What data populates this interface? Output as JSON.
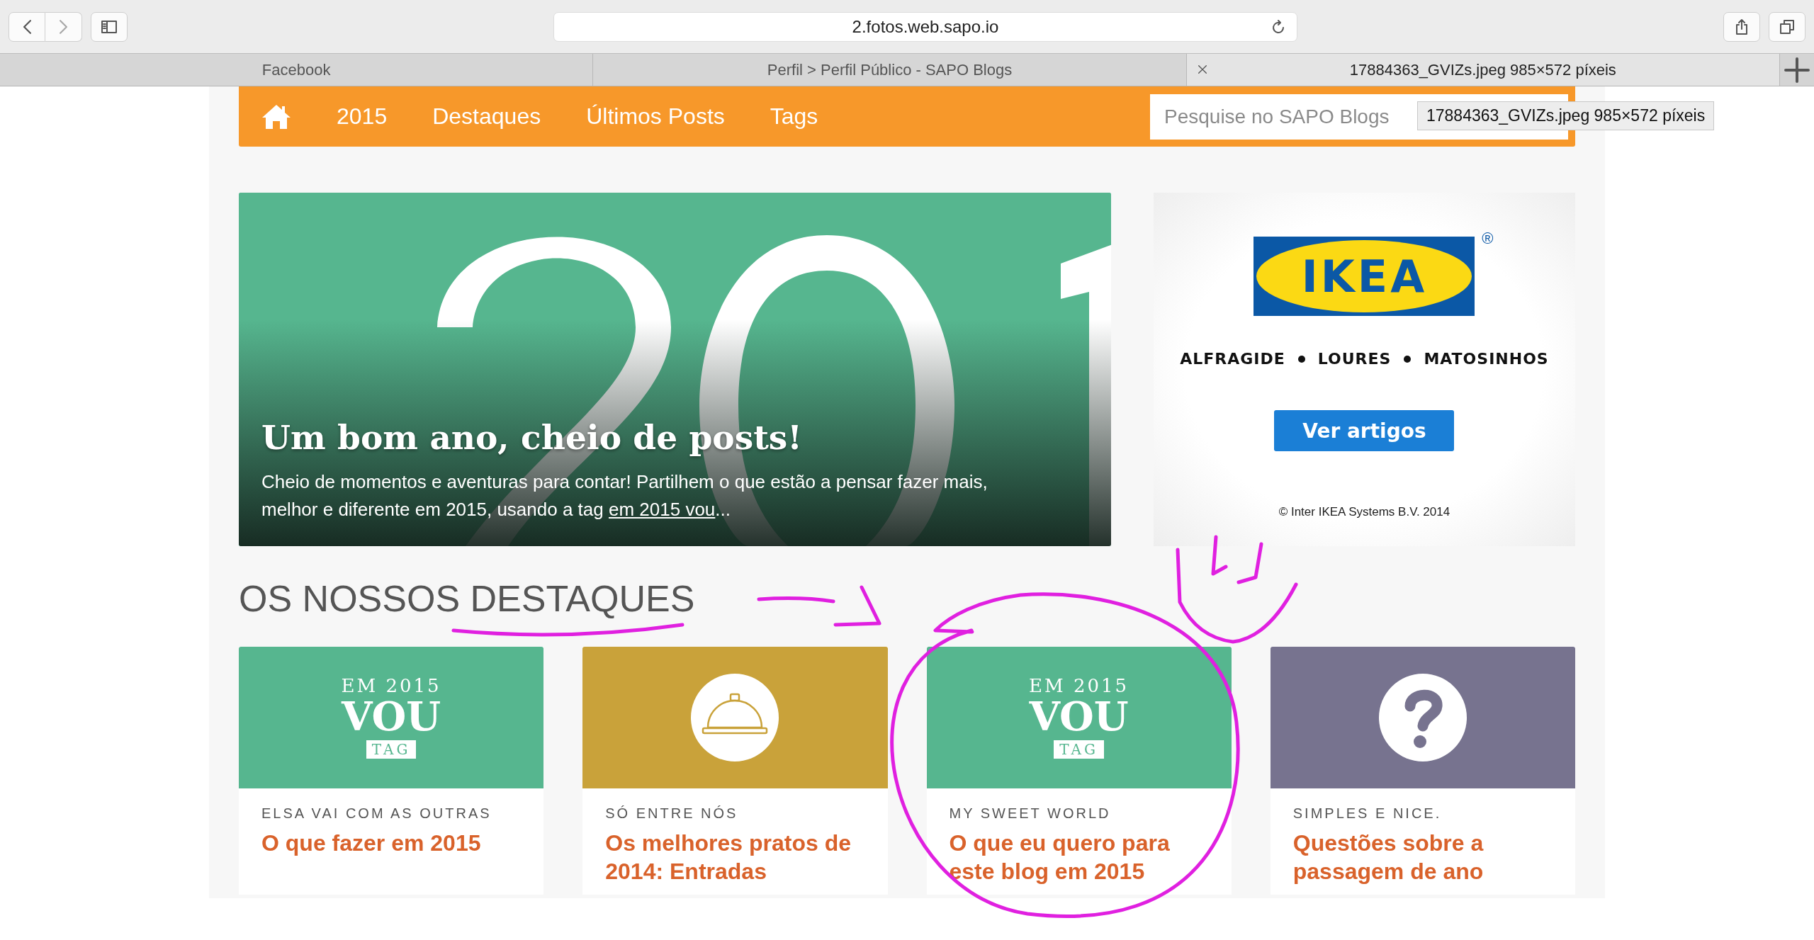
{
  "browser": {
    "back_disabled": false,
    "forward_disabled": true,
    "address": "2.fotos.web.sapo.io",
    "tabs": [
      {
        "title": "Facebook",
        "selected": false
      },
      {
        "title": "Perfil > Perfil Público - SAPO Blogs",
        "selected": false
      },
      {
        "title": "17884363_GVIZs.jpeg 985×572 píxeis",
        "selected": true
      }
    ],
    "tooltip": "17884363_GVIZs.jpeg 985×572 píxeis"
  },
  "nav": {
    "items": [
      "2015",
      "Destaques",
      "Últimos Posts",
      "Tags"
    ],
    "search": {
      "placeholder": "Pesquise no SAPO Blogs"
    }
  },
  "hero": {
    "title": "Um bom ano, cheio de posts!",
    "body": "Cheio de momentos e aventuras para contar! Partilhem o que estão a pensar fazer mais, melhor e diferente em 2015, usando a tag ",
    "link": "em 2015 vou",
    "after": "..."
  },
  "ad": {
    "logo": "IKEA",
    "registered": "®",
    "locations": [
      "ALFRAGIDE",
      "LOURES",
      "MATOSINHOS"
    ],
    "button": "Ver artigos",
    "copyright": "© Inter IKEA Systems B.V. 2014"
  },
  "section_title": "OS NOSSOS DESTAQUES",
  "cards": [
    {
      "kind": "vou",
      "color": "#56b68f",
      "badge": {
        "top": "EM 2015",
        "main": "VOU",
        "tag": "TAG"
      },
      "blog": "ELSA VAI COM AS OUTRAS",
      "title": "O que fazer em 2015"
    },
    {
      "kind": "cloche",
      "color": "#c9a23a",
      "blog": "SÓ ENTRE NÓS",
      "title": "Os melhores pratos de 2014: Entradas"
    },
    {
      "kind": "vou",
      "color": "#56b68f",
      "badge": {
        "top": "EM 2015",
        "main": "VOU",
        "tag": "TAG"
      },
      "blog": "MY SWEET WORLD",
      "title": "O que eu quero para este blog em 2015"
    },
    {
      "kind": "question",
      "color": "#77738f",
      "blog": "SIMPLES E NICE.",
      "title": "Questões sobre a passagem de ano"
    }
  ]
}
